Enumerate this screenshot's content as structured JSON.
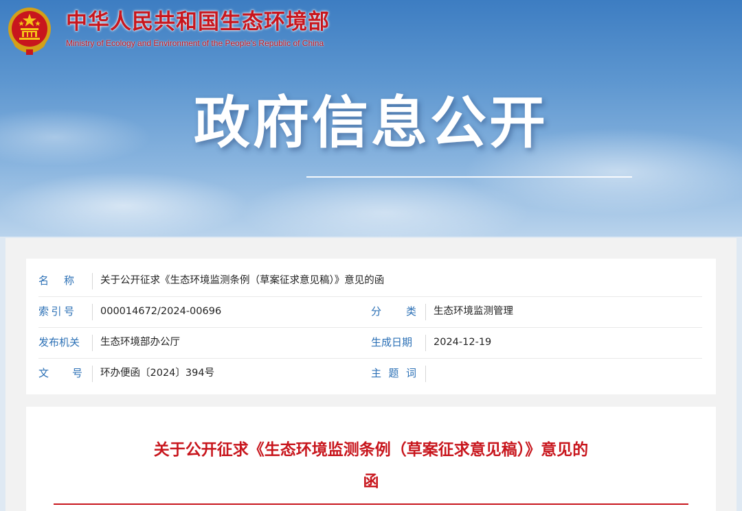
{
  "header": {
    "ministry_cn": "中华人民共和国生态环境部",
    "ministry_en": "Ministry of Ecology and Environment of the People's Republic of China",
    "emblem_icon": "national-emblem-icon",
    "page_heading": "政府信息公开"
  },
  "info": {
    "name_label": [
      "名",
      "称"
    ],
    "name_value": "关于公开征求《生态环境监测条例（草案征求意见稿）》意见的函",
    "index_label": [
      "索",
      "引",
      "号"
    ],
    "index_value": "000014672/2024-00696",
    "category_label": [
      "分",
      "类"
    ],
    "category_value": "生态环境监测管理",
    "issuer_label": "发布机关",
    "issuer_value": "生态环境部办公厅",
    "date_label": "生成日期",
    "date_value": "2024-12-19",
    "docno_label": [
      "文",
      "号"
    ],
    "docno_value": "环办便函〔2024〕394号",
    "subject_label": [
      "主",
      "题",
      "词"
    ],
    "subject_value": ""
  },
  "document": {
    "title_line1": "关于公开征求《生态环境监测条例（草案征求意见稿）》意见的",
    "title_line2": "函"
  },
  "colors": {
    "brand_red": "#c8161d",
    "label_blue": "#2a6fb5",
    "sky_blue": "#5e97d0"
  }
}
